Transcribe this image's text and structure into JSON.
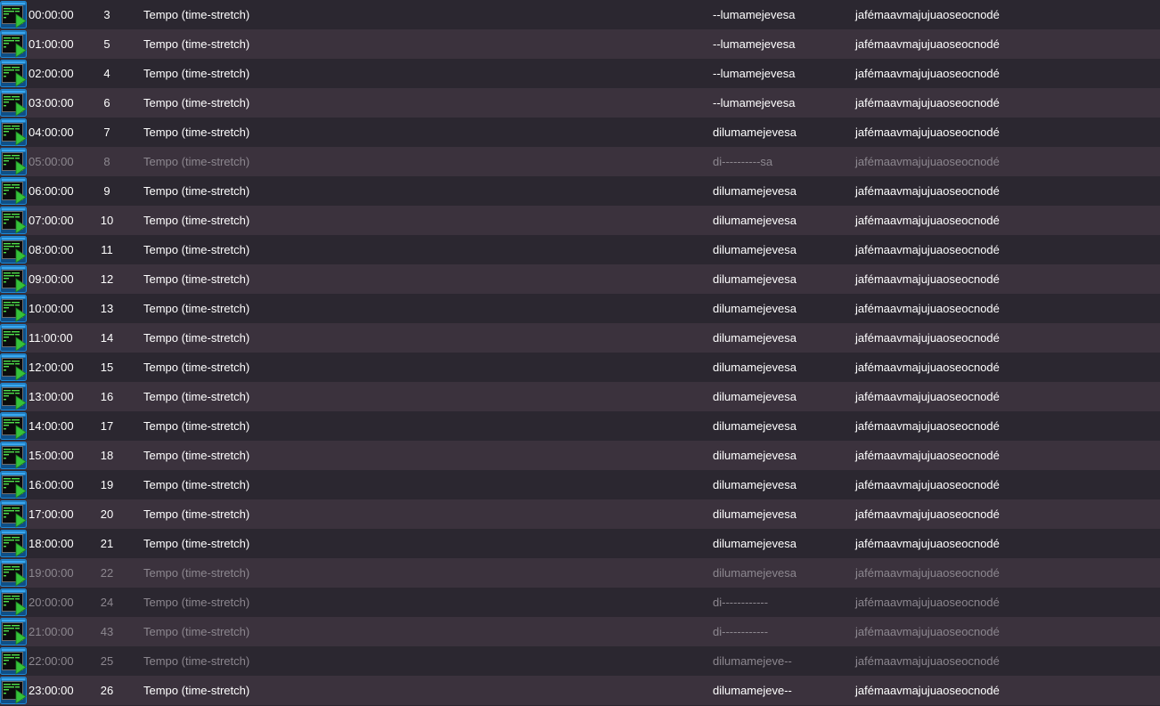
{
  "rows": [
    {
      "time": "00:00:00",
      "num": "3",
      "effect": "Tempo (time-stretch)",
      "name": "--lumamejevesa",
      "extra": "jafémaavmajujuaoseocnodé",
      "dim": false
    },
    {
      "time": "01:00:00",
      "num": "5",
      "effect": "Tempo (time-stretch)",
      "name": "--lumamejevesa",
      "extra": "jafémaavmajujuaoseocnodé",
      "dim": false
    },
    {
      "time": "02:00:00",
      "num": "4",
      "effect": "Tempo (time-stretch)",
      "name": "--lumamejevesa",
      "extra": "jafémaavmajujuaoseocnodé",
      "dim": false
    },
    {
      "time": "03:00:00",
      "num": "6",
      "effect": "Tempo (time-stretch)",
      "name": "--lumamejevesa",
      "extra": "jafémaavmajujuaoseocnodé",
      "dim": false
    },
    {
      "time": "04:00:00",
      "num": "7",
      "effect": "Tempo (time-stretch)",
      "name": "dilumamejevesa",
      "extra": "jafémaavmajujuaoseocnodé",
      "dim": false
    },
    {
      "time": "05:00:00",
      "num": "8",
      "effect": "Tempo (time-stretch)",
      "name": "di----------sa",
      "extra": "jafémaavmajujuaoseocnodé",
      "dim": true
    },
    {
      "time": "06:00:00",
      "num": "9",
      "effect": "Tempo (time-stretch)",
      "name": "dilumamejevesa",
      "extra": "jafémaavmajujuaoseocnodé",
      "dim": false
    },
    {
      "time": "07:00:00",
      "num": "10",
      "effect": "Tempo (time-stretch)",
      "name": "dilumamejevesa",
      "extra": "jafémaavmajujuaoseocnodé",
      "dim": false
    },
    {
      "time": "08:00:00",
      "num": "11",
      "effect": "Tempo (time-stretch)",
      "name": "dilumamejevesa",
      "extra": "jafémaavmajujuaoseocnodé",
      "dim": false
    },
    {
      "time": "09:00:00",
      "num": "12",
      "effect": "Tempo (time-stretch)",
      "name": "dilumamejevesa",
      "extra": "jafémaavmajujuaoseocnodé",
      "dim": false
    },
    {
      "time": "10:00:00",
      "num": "13",
      "effect": "Tempo (time-stretch)",
      "name": "dilumamejevesa",
      "extra": "jafémaavmajujuaoseocnodé",
      "dim": false
    },
    {
      "time": "11:00:00",
      "num": "14",
      "effect": "Tempo (time-stretch)",
      "name": "dilumamejevesa",
      "extra": "jafémaavmajujuaoseocnodé",
      "dim": false
    },
    {
      "time": "12:00:00",
      "num": "15",
      "effect": "Tempo (time-stretch)",
      "name": "dilumamejevesa",
      "extra": "jafémaavmajujuaoseocnodé",
      "dim": false
    },
    {
      "time": "13:00:00",
      "num": "16",
      "effect": "Tempo (time-stretch)",
      "name": "dilumamejevesa",
      "extra": "jafémaavmajujuaoseocnodé",
      "dim": false
    },
    {
      "time": "14:00:00",
      "num": "17",
      "effect": "Tempo (time-stretch)",
      "name": "dilumamejevesa",
      "extra": "jafémaavmajujuaoseocnodé",
      "dim": false
    },
    {
      "time": "15:00:00",
      "num": "18",
      "effect": "Tempo (time-stretch)",
      "name": "dilumamejevesa",
      "extra": "jafémaavmajujuaoseocnodé",
      "dim": false
    },
    {
      "time": "16:00:00",
      "num": "19",
      "effect": "Tempo (time-stretch)",
      "name": "dilumamejevesa",
      "extra": "jafémaavmajujuaoseocnodé",
      "dim": false
    },
    {
      "time": "17:00:00",
      "num": "20",
      "effect": "Tempo (time-stretch)",
      "name": "dilumamejevesa",
      "extra": "jafémaavmajujuaoseocnodé",
      "dim": false
    },
    {
      "time": "18:00:00",
      "num": "21",
      "effect": "Tempo (time-stretch)",
      "name": "dilumamejevesa",
      "extra": "jafémaavmajujuaoseocnodé",
      "dim": false
    },
    {
      "time": "19:00:00",
      "num": "22",
      "effect": "Tempo (time-stretch)",
      "name": "dilumamejevesa",
      "extra": "jafémaavmajujuaoseocnodé",
      "dim": true
    },
    {
      "time": "20:00:00",
      "num": "24",
      "effect": "Tempo (time-stretch)",
      "name": "di------------",
      "extra": "jafémaavmajujuaoseocnodé",
      "dim": true
    },
    {
      "time": "21:00:00",
      "num": "43",
      "effect": "Tempo (time-stretch)",
      "name": "di------------",
      "extra": "jafémaavmajujuaoseocnodé",
      "dim": true
    },
    {
      "time": "22:00:00",
      "num": "25",
      "effect": "Tempo (time-stretch)",
      "name": "dilumamejeve--",
      "extra": "jafémaavmajujuaoseocnodé",
      "dim": true
    },
    {
      "time": "23:00:00",
      "num": "26",
      "effect": "Tempo (time-stretch)",
      "name": "dilumamejeve--",
      "extra": "jafémaavmajujuaoseocnodé",
      "dim": false
    }
  ],
  "icon": "clip-thumbnail-icon",
  "colors": {
    "row_even": "#2b2730",
    "row_odd": "#3b323d",
    "text": "#ffffff",
    "text_dim": "#8c878f",
    "icon_frame": "#1d88d6",
    "icon_screen": "#0c0c0c",
    "icon_text": "#4fe04a",
    "icon_play": "#35c23a"
  }
}
